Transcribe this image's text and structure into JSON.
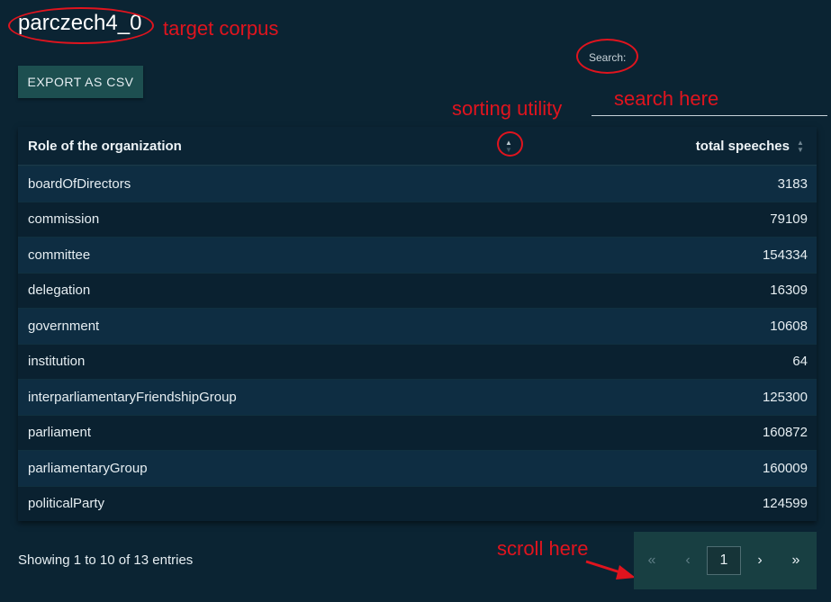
{
  "corpus_title": "parczech4_0",
  "annotations": {
    "target_corpus": "target corpus",
    "search_here": "search here",
    "sorting_utility": "sorting utility",
    "scroll_here": "scroll here",
    "annotation_color": "#e0141e"
  },
  "toolbar": {
    "export_label": "EXPORT AS CSV"
  },
  "search": {
    "label": "Search:",
    "value": ""
  },
  "table": {
    "columns": [
      "Role of the organization",
      "total speeches"
    ],
    "rows": [
      {
        "role": "boardOfDirectors",
        "total": "3183"
      },
      {
        "role": "commission",
        "total": "79109"
      },
      {
        "role": "committee",
        "total": "154334"
      },
      {
        "role": "delegation",
        "total": "16309"
      },
      {
        "role": "government",
        "total": "10608"
      },
      {
        "role": "institution",
        "total": "64"
      },
      {
        "role": "interparliamentaryFriendshipGroup",
        "total": "125300"
      },
      {
        "role": "parliament",
        "total": "160872"
      },
      {
        "role": "parliamentaryGroup",
        "total": "160009"
      },
      {
        "role": "politicalParty",
        "total": "124599"
      }
    ]
  },
  "footer": {
    "info": "Showing 1 to 10 of 13 entries"
  },
  "pagination": {
    "first": "«",
    "prev": "‹",
    "current": "1",
    "next": "›",
    "last": "»"
  },
  "colors": {
    "background": "#0b2433",
    "accent": "#1d4f50"
  }
}
